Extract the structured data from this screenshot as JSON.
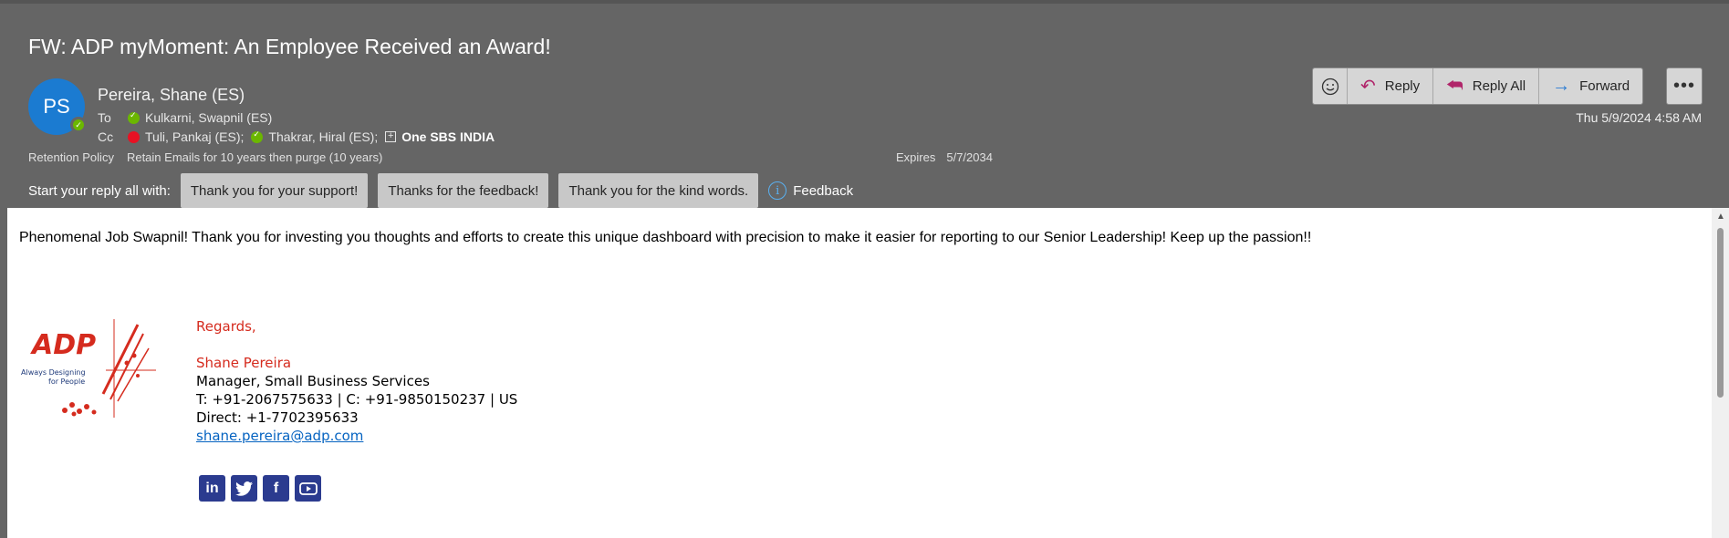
{
  "subject": "FW: ADP myMoment: An Employee Received an Award!",
  "sender": {
    "initials": "PS",
    "name": "Pereira, Shane (ES)"
  },
  "to": {
    "label": "To",
    "recipients": [
      "Kulkarni, Swapnil (ES)"
    ]
  },
  "cc": {
    "label": "Cc",
    "recipients": [
      "Tuli, Pankaj (ES);",
      "Thakrar, Hiral (ES);",
      "One SBS INDIA"
    ]
  },
  "retention": {
    "label": "Retention Policy",
    "value": "Retain Emails for 10 years then purge (10 years)",
    "expires_label": "Expires",
    "expires_value": "5/7/2034"
  },
  "actions": {
    "reply": "Reply",
    "reply_all": "Reply All",
    "forward": "Forward"
  },
  "date": "Thu 5/9/2024 4:58 AM",
  "quick_reply": {
    "prompt": "Start your reply all with:",
    "suggestions": [
      "Thank you for your support!",
      "Thanks for the feedback!",
      "Thank you for the kind words."
    ],
    "feedback": "Feedback"
  },
  "body": {
    "message": "Phenomenal Job Swapnil! Thank you for investing you thoughts and efforts to create this unique dashboard with precision to make it easier for reporting to our Senior Leadership! Keep up the passion!!",
    "logo_text": "ADP",
    "logo_tagline_1": "Always Designing",
    "logo_tagline_2": "for People",
    "signature": {
      "regards": "Regards,",
      "name": "Shane Pereira",
      "title": "Manager, Small Business Services",
      "phones": "T: +91-2067575633 | C: +91-9850150237 | US",
      "direct": "Direct: +1-7702395633",
      "email": "shane.pereira@adp.com"
    },
    "social_icons": [
      "linkedin-icon",
      "twitter-icon",
      "facebook-icon",
      "youtube-icon"
    ]
  },
  "colors": {
    "header_bg": "#656565",
    "avatar": "#1b7bd1",
    "presence_green": "#6bb700",
    "presence_red": "#e81123",
    "signature_red": "#d52b1e",
    "link": "#0563c1"
  }
}
